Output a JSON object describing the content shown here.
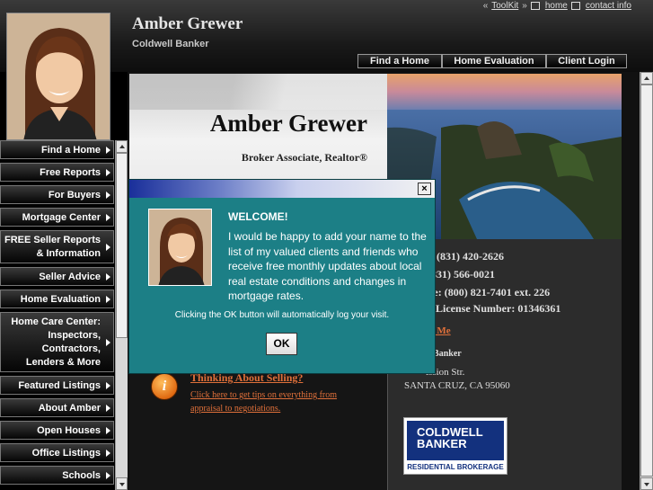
{
  "header": {
    "agent_name": "Amber Grewer",
    "company": "Coldwell Banker",
    "toplinks": {
      "prefix": "«",
      "toolkit": "ToolKit",
      "suffix": "»",
      "home": "home",
      "contact": "contact info"
    }
  },
  "topnav": [
    {
      "label": "Find a Home"
    },
    {
      "label": "Home Evaluation"
    },
    {
      "label": "Client Login"
    }
  ],
  "sidebar": [
    {
      "label": "Find a Home"
    },
    {
      "label": "Free Reports"
    },
    {
      "label": "For Buyers"
    },
    {
      "label": "Mortgage Center"
    },
    {
      "label": "FREE Seller Reports & Information"
    },
    {
      "label": "Seller Advice"
    },
    {
      "label": "Home Evaluation"
    },
    {
      "label": "Home Care Center: Inspectors, Contractors, Lenders & More"
    },
    {
      "label": "Featured Listings"
    },
    {
      "label": "About Amber"
    },
    {
      "label": "Open Houses"
    },
    {
      "label": "Office Listings"
    },
    {
      "label": "Schools"
    }
  ],
  "banner": {
    "name": "Amber Grewer",
    "title": "Broker Associate, Realtor®"
  },
  "contact": {
    "phone1": "(831) 420-2626",
    "phone2": "831) 566-0021",
    "tollfree": "ree: (800) 821-7401 ext. 226",
    "license": "E License Number: 01346361",
    "email_link": "ail Me",
    "company_short": "ll Banker",
    "street": "ission Str.",
    "city": "SANTA CRUZ, CA 95060"
  },
  "logo": {
    "line1": "COLDWELL",
    "line2": "BANKER",
    "sub": "RESIDENTIAL BROKERAGE"
  },
  "selling": {
    "icon_glyph": "i",
    "title": "Thinking About Selling?",
    "text": "Click here to get tips on everything from appraisal to negotiations."
  },
  "dialog": {
    "close_glyph": "×",
    "heading": "WELCOME!",
    "body": "I would be happy to add your name to the list of my valued clients and friends who receive free monthly updates about local real estate conditions and changes in mortgage rates.",
    "note": "Clicking the OK button will automatically log your visit.",
    "ok_label": "OK"
  },
  "colors": {
    "dialog_bg": "#1c7f86",
    "link_orange": "#e0703a",
    "logo_blue": "#13317e"
  }
}
